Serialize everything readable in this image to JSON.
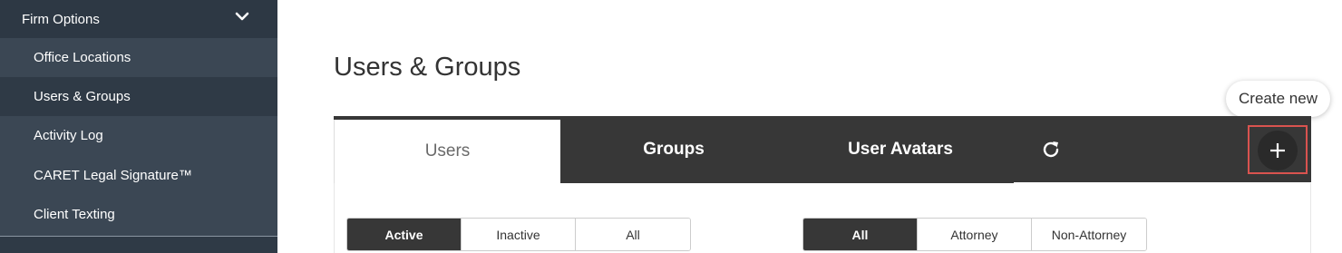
{
  "sidebar": {
    "header_label": "Firm Options",
    "items": [
      {
        "label": "Office Locations",
        "active": false
      },
      {
        "label": "Users & Groups",
        "active": true
      },
      {
        "label": "Activity Log",
        "active": false
      },
      {
        "label": "CARET Legal Signature™",
        "active": false
      },
      {
        "label": "Client Texting",
        "active": false
      }
    ]
  },
  "main": {
    "title": "Users & Groups",
    "tabs": [
      {
        "label": "Users",
        "active": true
      },
      {
        "label": "Groups",
        "active": false
      },
      {
        "label": "User Avatars",
        "active": false
      }
    ],
    "create_tooltip": "Create new",
    "status_filter": [
      "Active",
      "Inactive",
      "All"
    ],
    "status_selected": "Active",
    "type_filter": [
      "All",
      "Attorney",
      "Non-Attorney"
    ],
    "type_selected": "All"
  },
  "icons": {
    "header_chevron": "chevron-down-icon",
    "refresh": "refresh-icon",
    "create": "plus-icon"
  },
  "colors": {
    "sidebar_bg": "#3b4754",
    "tabbar_bg": "#373737",
    "highlight_outline": "#d9534f"
  }
}
